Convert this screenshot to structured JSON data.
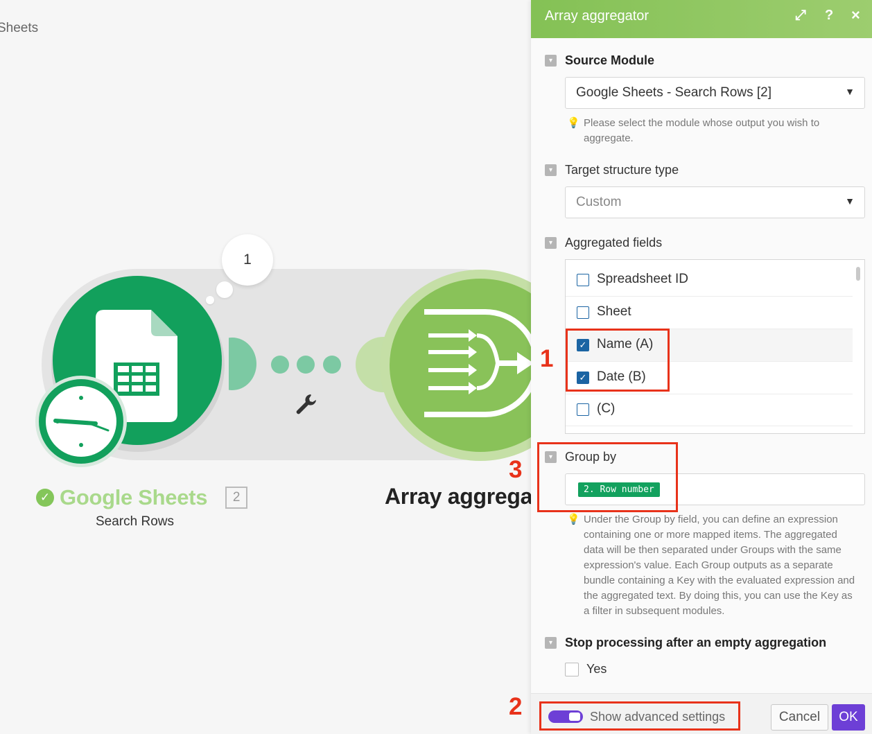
{
  "canvas": {
    "title": "Sheets",
    "bubble_count": "1",
    "modules": {
      "google_sheets": {
        "title": "Google Sheets",
        "subtitle": "Search Rows",
        "badge": "2"
      },
      "array_aggregator": {
        "title": "Array aggrega"
      }
    }
  },
  "panel": {
    "title": "Array aggregator",
    "header_icons": [
      "expand-icon",
      "help-icon",
      "close-icon"
    ],
    "help_icon_label": "?",
    "close_icon_label": "×",
    "expand_icon_label": "⤢",
    "source_module": {
      "label": "Source Module",
      "value": "Google Sheets - Search Rows [2]",
      "help": "Please select the module whose output you wish to aggregate."
    },
    "target_structure": {
      "label": "Target structure type",
      "value": "Custom"
    },
    "aggregated_fields": {
      "label": "Aggregated fields",
      "items": [
        {
          "label": "Spreadsheet ID",
          "checked": false
        },
        {
          "label": "Sheet",
          "checked": false
        },
        {
          "label": "Name (A)",
          "checked": true
        },
        {
          "label": "Date (B)",
          "checked": true
        },
        {
          "label": "(C)",
          "checked": false
        }
      ]
    },
    "group_by": {
      "label": "Group by",
      "pill": "2. Row number",
      "help": "Under the Group by field, you can define an expression containing one or more mapped items. The aggregated data will be then separated under Groups with the same expression's value. Each Group outputs as a separate bundle containing a Key with the evaluated expression and the aggregated text. By doing this, you can use the Key as a filter in subsequent modules."
    },
    "stop_processing": {
      "label": "Stop processing after an empty aggregation",
      "option": "Yes",
      "checked": false
    },
    "footer": {
      "advanced_toggle": "Show advanced settings",
      "advanced_on": true,
      "cancel": "Cancel",
      "ok": "OK"
    }
  },
  "annotations": [
    "1",
    "2",
    "3"
  ],
  "colors": {
    "brand_purple": "#6d3fd6",
    "sheets_green": "#12a05c",
    "aggregator_green": "#89c259",
    "annotation_red": "#e8321a",
    "checkbox_blue": "#1b64a3"
  }
}
